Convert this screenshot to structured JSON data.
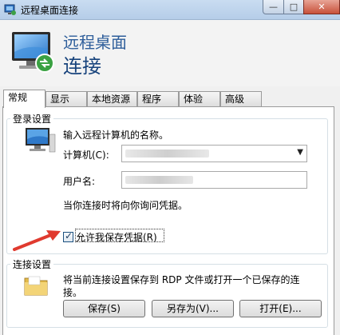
{
  "window": {
    "title": "远程桌面连接",
    "caption_min": "—",
    "caption_max": "□",
    "caption_close": "✕"
  },
  "header": {
    "line1": "远程桌面",
    "line2": "连接"
  },
  "tabs": [
    {
      "label": "常规",
      "active": true
    },
    {
      "label": "显示",
      "active": false
    },
    {
      "label": "本地资源",
      "active": false
    },
    {
      "label": "程序",
      "active": false
    },
    {
      "label": "体验",
      "active": false
    },
    {
      "label": "高级",
      "active": false
    }
  ],
  "login": {
    "legend": "登录设置",
    "prompt": "输入远程计算机的名称。",
    "computer_label": "计算机(C):",
    "computer_value": "",
    "username_label": "用户名:",
    "username_value": "",
    "notice": "当你连接时将向你询问凭据。",
    "allow_save_checked": true,
    "allow_save_label": "允许我保存凭据(R)"
  },
  "connection": {
    "legend": "连接设置",
    "description_line1": "将当前连接设置保存到 RDP 文件或打开一个已保存的连",
    "description_line2": "接。",
    "save_label": "保存(S)",
    "saveas_label": "另存为(V)...",
    "open_label": "打开(E)..."
  },
  "icons": {
    "app": "remote-desktop-icon",
    "header": "remote-desktop-icon",
    "computer": "computer-icon",
    "folder": "folder-icon"
  },
  "colors": {
    "header_line1": "#2d5d9a",
    "header_line2": "#17437c",
    "close_button": "#c7513a"
  }
}
